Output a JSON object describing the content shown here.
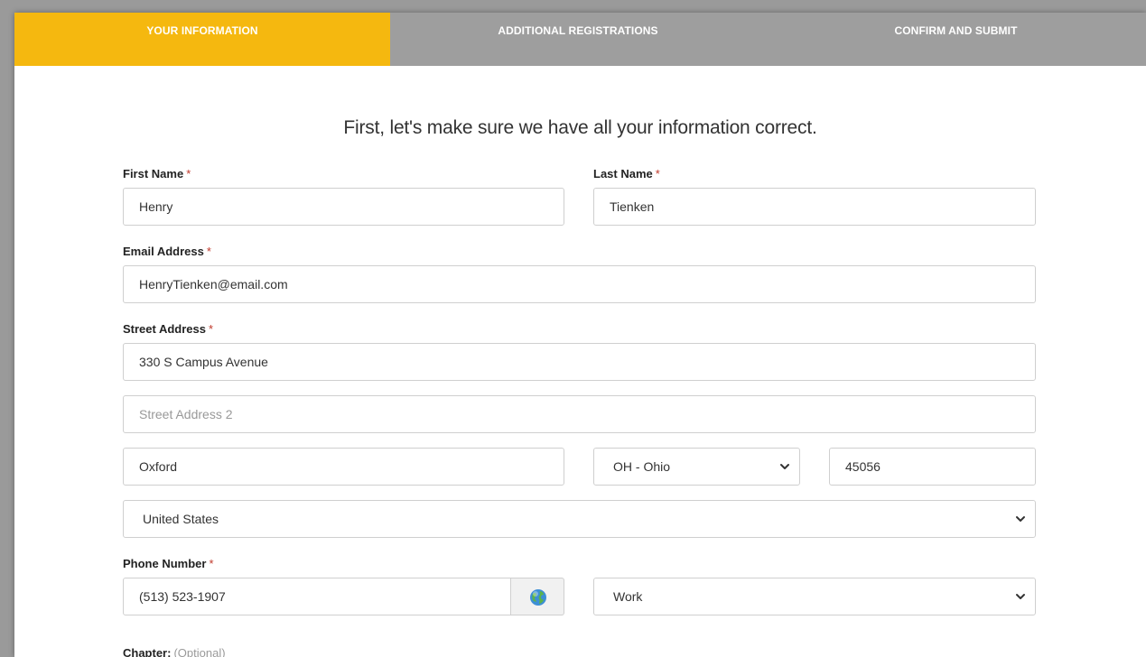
{
  "steps": [
    {
      "label": "YOUR INFORMATION",
      "active": true
    },
    {
      "label": "ADDITIONAL REGISTRATIONS",
      "active": false
    },
    {
      "label": "CONFIRM AND SUBMIT",
      "active": false
    }
  ],
  "headline": "First, let's make sure we have all your information correct.",
  "required_marker": "*",
  "fields": {
    "first_name": {
      "label": "First Name",
      "value": "Henry"
    },
    "last_name": {
      "label": "Last Name",
      "value": "Tienken"
    },
    "email": {
      "label": "Email Address",
      "value": "HenryTienken@email.com"
    },
    "street": {
      "label": "Street Address",
      "value": "330 S Campus Avenue"
    },
    "street2": {
      "placeholder": "Street Address 2",
      "value": ""
    },
    "city": {
      "value": "Oxford"
    },
    "state": {
      "value": "OH - Ohio"
    },
    "zip": {
      "value": "45056"
    },
    "country": {
      "value": "United States"
    },
    "phone": {
      "label": "Phone Number",
      "value": "(513) 523-1907"
    },
    "phone_type": {
      "value": "Work"
    },
    "chapter": {
      "label": "Chapter:",
      "optional": "(Optional)"
    }
  },
  "icons": {
    "globe": "globe-icon",
    "chevron": "chevron-down-icon"
  },
  "colors": {
    "active_step": "#f5b80f",
    "inactive_step": "#9e9e9e",
    "required": "#c0392b"
  }
}
